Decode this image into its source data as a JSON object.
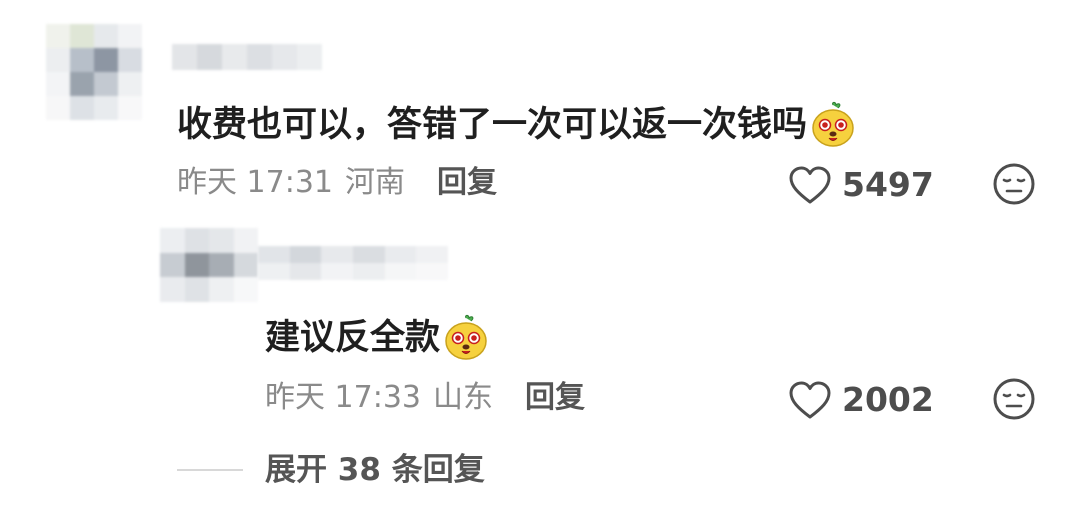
{
  "comment": {
    "text": "收费也可以，答错了一次可以返一次钱吗",
    "emoji": "yellow-mascot-emoji",
    "time": "昨天 17:31",
    "location": "河南",
    "reply_label": "回复",
    "likes": "5497",
    "like_icon": "heart-outline-icon",
    "react_icon": "neutral-face-icon"
  },
  "reply": {
    "text": "建议反全款",
    "emoji": "yellow-mascot-emoji",
    "time": "昨天 17:33",
    "location": "山东",
    "reply_label": "回复",
    "likes": "2002",
    "like_icon": "heart-outline-icon",
    "react_icon": "neutral-face-icon"
  },
  "expand": {
    "label": "展开 38 条回复"
  },
  "colors": {
    "text": "#1f1f1f",
    "meta": "#8a8a8a",
    "count": "#4d4d4d",
    "divider": "#d8d8d8",
    "emoji_yellow": "#f6d13e",
    "emoji_red": "#c8201e"
  }
}
